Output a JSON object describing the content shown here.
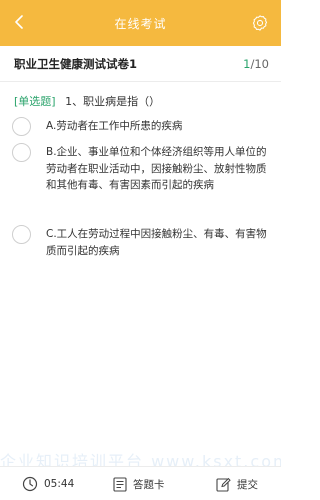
{
  "header": {
    "title": "在线考试",
    "back_icon": "chevron-left-icon",
    "settings_icon": "gear-icon"
  },
  "paper": {
    "title": "职业卫生健康测试试卷1",
    "current": "1",
    "total": "/10"
  },
  "question": {
    "type": "[单选题]",
    "number": "1、",
    "text": "职业病是指（）"
  },
  "options": [
    {
      "text": "A.劳动者在工作中所患的疾病"
    },
    {
      "text": "B.企业、事业单位和个体经济组织等用人单位的劳动者在职业活动中，因接触粉尘、放射性物质和其他有毒、有害因素而引起的疾病"
    },
    {
      "text": "C.工人在劳动过程中因接触粉尘、有毒、有害物质而引起的疾病"
    }
  ],
  "watermark": "企业知识培训平台  www.ksxt.com",
  "footer": {
    "timer": "05:44",
    "answer_card": "答题卡",
    "submit": "提交"
  },
  "colors": {
    "header_bg": "#f5b93f",
    "accent_green": "#2aa36b"
  }
}
